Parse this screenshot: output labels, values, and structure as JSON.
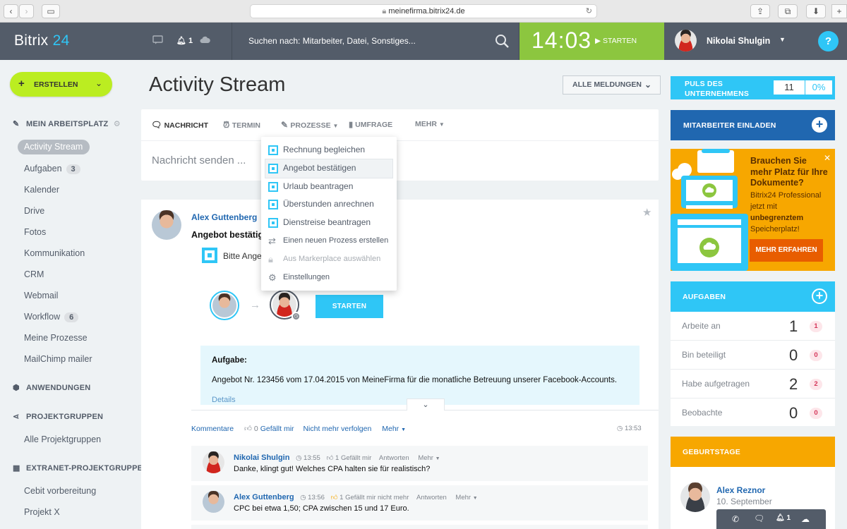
{
  "browser": {
    "url": "meinefirma.bitrix24.de"
  },
  "header": {
    "logo_main": "Bitrix",
    "logo_num": "24",
    "notif_count": "1",
    "search_placeholder": "Suchen nach: Mitarbeiter, Datei, Sonstiges...",
    "clock": "14:03",
    "start_label": "STARTEN",
    "user_name": "Nikolai Shulgin",
    "help": "?"
  },
  "sidebar": {
    "create_label": "ERSTELLEN",
    "workplace_title": "MEIN ARBEITSPLATZ",
    "items": [
      {
        "label": "Activity Stream"
      },
      {
        "label": "Aufgaben",
        "badge": "3"
      },
      {
        "label": "Kalender"
      },
      {
        "label": "Drive"
      },
      {
        "label": "Fotos"
      },
      {
        "label": "Kommunikation"
      },
      {
        "label": "CRM"
      },
      {
        "label": "Webmail"
      },
      {
        "label": "Workflow",
        "badge": "6"
      },
      {
        "label": "Meine Prozesse"
      },
      {
        "label": "MailChimp mailer"
      }
    ],
    "apps_title": "ANWENDUNGEN",
    "groups_title": "PROJEKTGRUPPEN",
    "groups_item": "Alle Projektgruppen",
    "extranet_title": "EXTRANET-PROJEKTGRUPPEN",
    "extranet_items": [
      "Cebit vorbereitung",
      "Projekt X"
    ]
  },
  "main": {
    "title": "Activity Stream",
    "filter_label": "ALLE MELDUNGEN",
    "tabs": [
      "NACHRICHT",
      "TERMIN",
      "PROZESSE",
      "UMFRAGE",
      "MEHR"
    ],
    "composer_placeholder": "Nachricht senden ..."
  },
  "dropdown": {
    "items": [
      "Rechnung begleichen",
      "Angebot bestätigen",
      "Urlaub beantragen",
      "Überstunden anrechnen",
      "Dienstreise beantragen",
      "Einen neuen Prozess erstellen",
      "Aus Markerplace auswählen",
      "Einstellungen"
    ]
  },
  "post": {
    "author": "Alex Guttenberg",
    "title": "Angebot bestätigen",
    "subtitle": "Bitte Angebot bestätigen",
    "start_button": "STARTEN",
    "task_heading": "Aufgabe:",
    "task_text": "Angebot Nr. 123456 vom 17.04.2015 von MeineFirma für die monatliche Betreuung unserer Facebook-Accounts.",
    "details_link": "Details",
    "actions": {
      "comments": "Kommentare",
      "like_count": "0",
      "like_label": "Gefällt mir",
      "unfollow": "Nicht mehr verfolgen",
      "more": "Mehr",
      "time": "13:53"
    },
    "comments": [
      {
        "author": "Nikolai Shulgin",
        "time": "13:55",
        "likes": "1 Gefällt mir",
        "reply": "Antworten",
        "more": "Mehr",
        "text": "Danke, klingt gut! Welches CPA halten sie für realistisch?"
      },
      {
        "author": "Alex Guttenberg",
        "time": "13:56",
        "likes": "1 Gefällt mir nicht mehr",
        "reply": "Antworten",
        "more": "Mehr",
        "text": "CPC bei etwa 1,50; CPA zwischen 15 und 17 Euro."
      }
    ]
  },
  "right": {
    "pulse_title_1": "PULS DES",
    "pulse_title_2": "UNTERNEHMENS",
    "pulse_count": "11",
    "pulse_percent": "0%",
    "invite_label": "MITARBEITER EINLADEN",
    "promo_title": "Brauchen Sie mehr Platz für Ihre Dokumente?",
    "promo_line1": "Bitrix24 Professional",
    "promo_line2": "jetzt mit",
    "promo_bold": "unbegrenztem",
    "promo_line3": "Speicherplatz!",
    "promo_button": "MEHR ERFAHREN",
    "tasks_title": "AUFGABEN",
    "tasks": [
      {
        "label": "Arbeite an",
        "count": "1",
        "badge": "1"
      },
      {
        "label": "Bin beteiligt",
        "count": "0",
        "badge": "0"
      },
      {
        "label": "Habe aufgetragen",
        "count": "2",
        "badge": "2"
      },
      {
        "label": "Beobachte",
        "count": "0",
        "badge": "0"
      }
    ],
    "birthdays_title": "GEBURTSTAGE",
    "birthday_name": "Alex Reznor",
    "birthday_date": "10. September",
    "bottom_notif": "1"
  },
  "colors": {
    "header": "#535c69",
    "accent": "#2fc6f6",
    "clock_bg": "#8cc63f",
    "create_btn": "#bbed21",
    "promo": "#f7a700",
    "link": "#2067b0"
  }
}
